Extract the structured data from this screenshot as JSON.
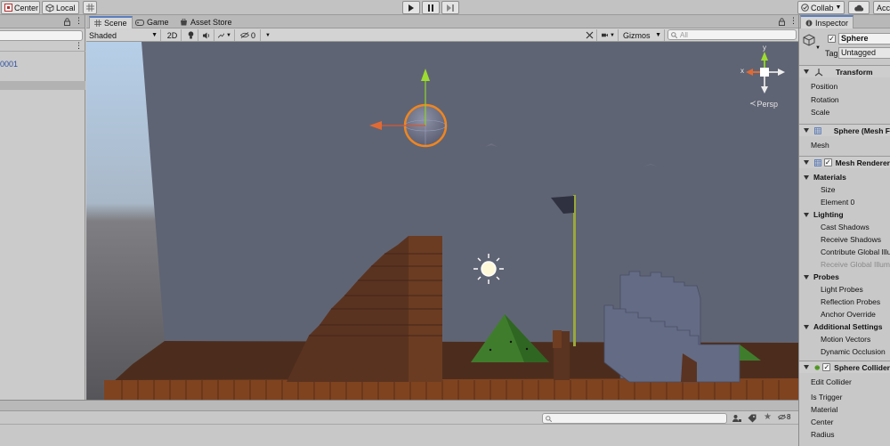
{
  "toolbar": {
    "pivot_label": "Center",
    "space_label": "Local",
    "collab_label": "Collab",
    "account_label": "Acc"
  },
  "hierarchy": {
    "item_text": "0001"
  },
  "scene": {
    "tabs": [
      {
        "label": "Scene",
        "icon": "grid-icon"
      },
      {
        "label": "Game",
        "icon": "gamepad-icon"
      },
      {
        "label": "Asset Store",
        "icon": "store-icon"
      }
    ],
    "shading_mode": "Shaded",
    "mode_2d": "2D",
    "hidden_count": "0",
    "gizmos_label": "Gizmos",
    "search_placeholder": "All",
    "persp_label": "Persp",
    "axis_x": "x",
    "axis_y": "y"
  },
  "inspector": {
    "tab_label": "Inspector",
    "object_name": "Sphere",
    "tag_label": "Tag",
    "tag_value": "Untagged",
    "transform": {
      "title": "Transform",
      "rows": [
        "Position",
        "Rotation",
        "Scale"
      ]
    },
    "mesh_filter": {
      "title": "Sphere (Mesh F",
      "rows": [
        "Mesh"
      ]
    },
    "mesh_renderer": {
      "title": "Mesh Renderer",
      "materials_label": "Materials",
      "size_label": "Size",
      "element_label": "Element 0",
      "lighting_label": "Lighting",
      "cast_shadows": "Cast Shadows",
      "receive_shadows": "Receive Shadows",
      "contribute_gi": "Contribute Global Illu",
      "receive_gi": "Receive Global Illum",
      "probes_label": "Probes",
      "light_probes": "Light Probes",
      "reflection_probes": "Reflection Probes",
      "anchor_override": "Anchor Override",
      "additional_label": "Additional Settings",
      "motion_vectors": "Motion Vectors",
      "dynamic_occlusion": "Dynamic Occlusion"
    },
    "sphere_collider": {
      "title": "Sphere Collider",
      "rows": [
        "Edit Collider",
        "Is Trigger",
        "Material",
        "Center",
        "Radius"
      ]
    }
  },
  "bottom": {
    "hidden_count": "8"
  }
}
